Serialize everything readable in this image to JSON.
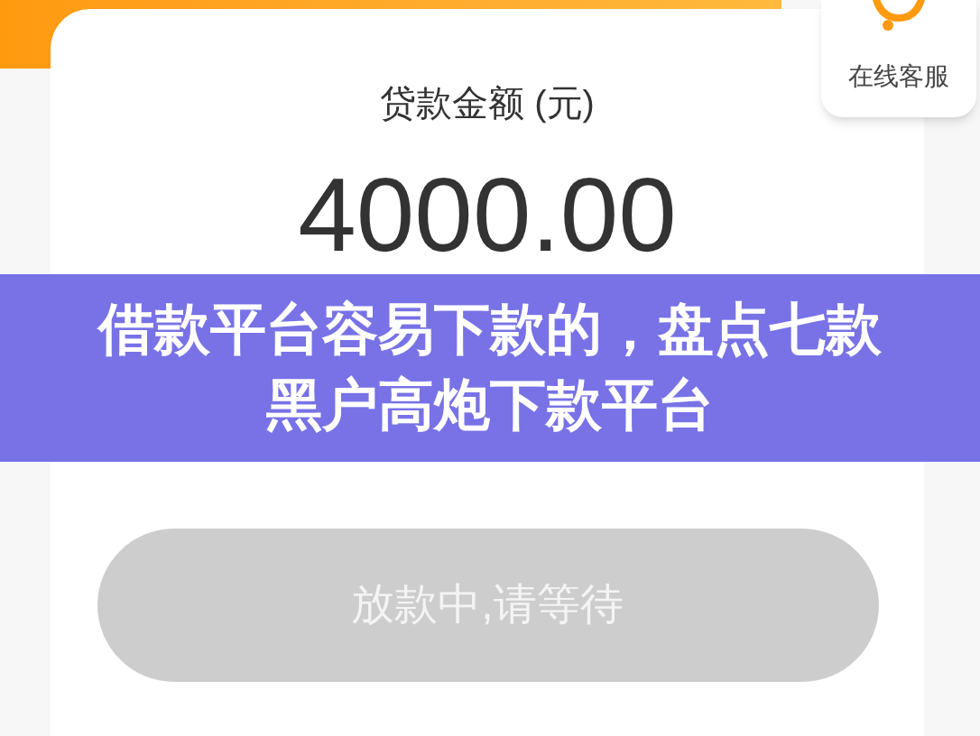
{
  "service": {
    "label": "在线客服"
  },
  "loan": {
    "label": "贷款金额 (元)",
    "amount": "4000.00"
  },
  "banner": {
    "title": "借款平台容易下款的，盘点七款黑户高炮下款平台"
  },
  "submit_button": {
    "label": "放款中,请等待",
    "disabled": true
  }
}
